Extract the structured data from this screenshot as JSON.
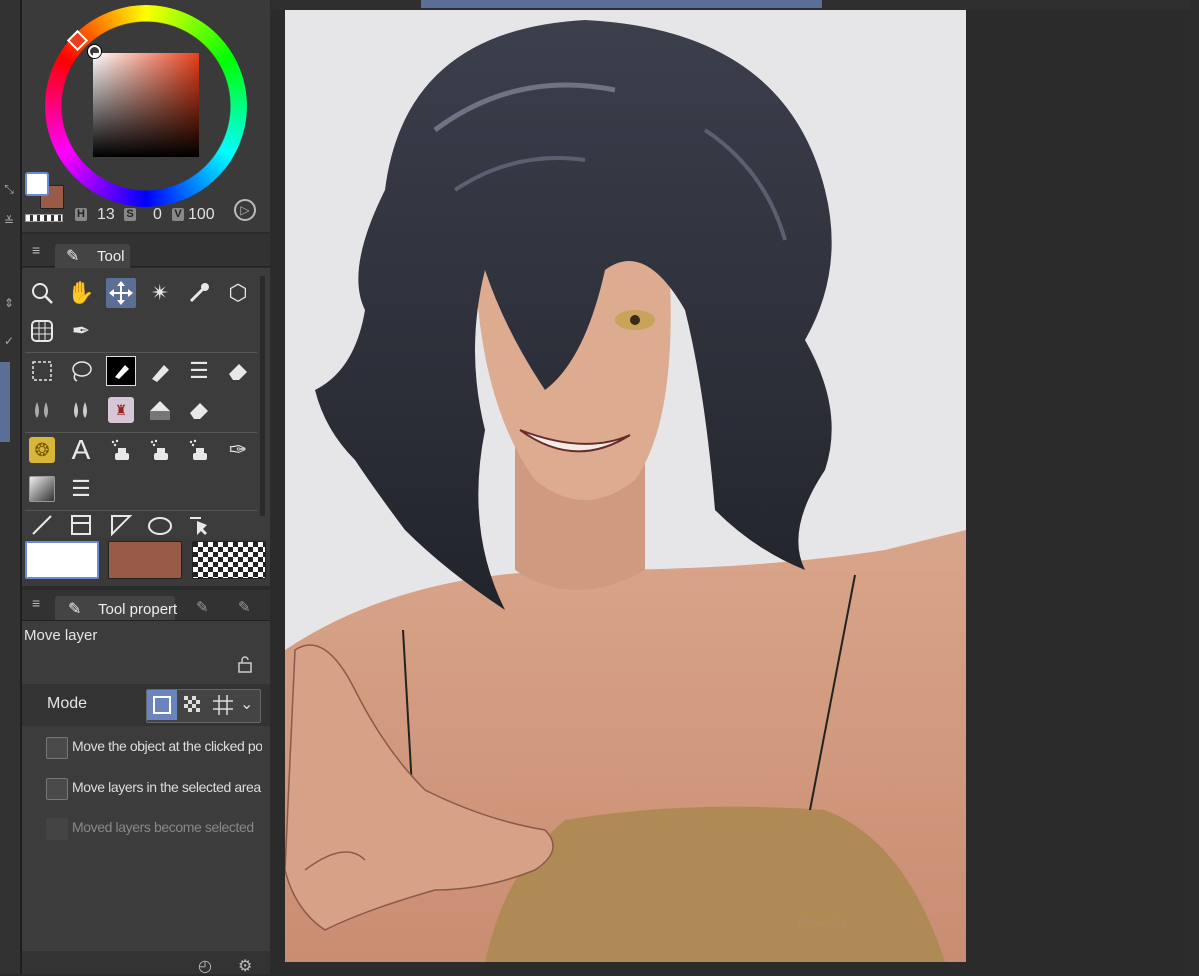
{
  "colors": {
    "main": "#e8401a",
    "foreground": "#ffffff",
    "background": "#9a5a48",
    "accent": "#5b6f96"
  },
  "color_panel": {
    "hsv": {
      "h_label": "H",
      "h_value": "13",
      "s_label": "S",
      "s_value": "0",
      "v_label": "V",
      "v_value": "100"
    }
  },
  "tool_palette": {
    "tab_label": "Tool",
    "tools": [
      "zoom-icon",
      "hand-icon",
      "move-icon",
      "magic-wand-icon",
      "eyedropper-icon",
      "3d-object-icon",
      "grid-icon",
      "pen-icon",
      "marquee-icon",
      "lasso-icon",
      "fill-icon",
      "correction-icon",
      "lines-icon",
      "eraser-icon",
      "blend-icon",
      "blend-icon",
      "texture-icon",
      "bucket-icon",
      "eraser-icon",
      "sticker-icon",
      "text-icon",
      "airbrush-icon",
      "airbrush-icon",
      "airbrush-icon",
      "pen-nib-icon",
      "gradient-icon",
      "hatch-icon",
      "line-icon",
      "frame-icon",
      "ruler-icon",
      "ellipse-icon",
      "select-icon"
    ]
  },
  "tool_property": {
    "tab_label": "Tool propert",
    "title": "Move layer",
    "mode_label": "Mode",
    "checkboxes": [
      {
        "label": "Move the object at the clicked posit",
        "checked": false,
        "enabled": true
      },
      {
        "label": "Move layers in the selected area",
        "checked": false,
        "enabled": true
      },
      {
        "label": "Moved layers become selected",
        "checked": false,
        "enabled": false
      }
    ]
  },
  "canvas": {
    "signature": "Elizobella"
  }
}
